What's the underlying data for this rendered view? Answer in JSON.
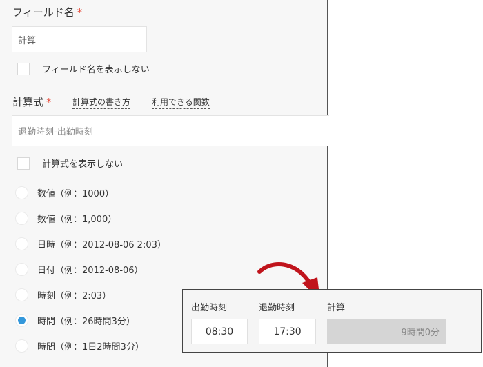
{
  "field_name": {
    "label": "フィールド名",
    "required_mark": "*",
    "value": "計算",
    "hide_checkbox_label": "フィールド名を表示しない"
  },
  "formula": {
    "label": "計算式",
    "required_mark": "*",
    "help_link": "計算式の書き方",
    "functions_link": "利用できる関数",
    "value": "退勤時刻-出勤時刻",
    "hide_checkbox_label": "計算式を表示しない"
  },
  "format_options": [
    {
      "label": "数値（例：1000）",
      "selected": false
    },
    {
      "label": "数値（例：1,000）",
      "selected": false
    },
    {
      "label": "日時（例：2012-08-06 2:03）",
      "selected": false
    },
    {
      "label": "日付（例：2012-08-06）",
      "selected": false
    },
    {
      "label": "時刻（例：2:03）",
      "selected": false
    },
    {
      "label": "時間（例：26時間3分）",
      "selected": true
    },
    {
      "label": "時間（例：1日2時間3分）",
      "selected": false
    }
  ],
  "preview": {
    "start_label": "出勤時刻",
    "start_value": "08:30",
    "end_label": "退勤時刻",
    "end_value": "17:30",
    "result_label": "計算",
    "result_value": "9時間0分"
  },
  "colors": {
    "required": "#e74c3c",
    "radio_selected": "#3498db",
    "arrow": "#c0141c"
  }
}
